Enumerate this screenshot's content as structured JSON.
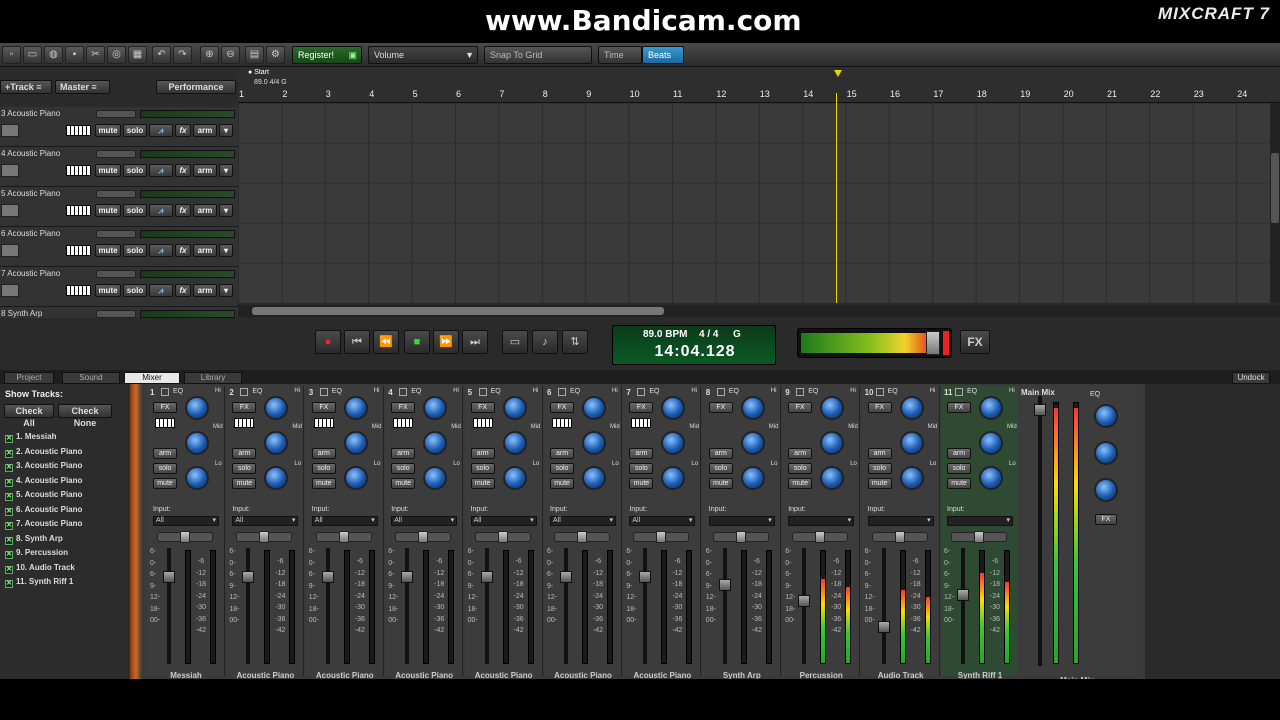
{
  "watermark": "www.Bandicam.com",
  "logo": "MIXCRAFT 7",
  "toolbar": {
    "register_label": "Register!",
    "volume_label": "Volume",
    "snap_label": "Snap To Grid",
    "time_label": "Time",
    "beats_label": "Beats"
  },
  "track_header": {
    "add_track": "+Track",
    "master": "Master",
    "performance": "Performance",
    "tracks": [
      {
        "name": "3 Acoustic Piano"
      },
      {
        "name": "4 Acoustic Piano"
      },
      {
        "name": "5 Acoustic Piano"
      },
      {
        "name": "6 Acoustic Piano"
      },
      {
        "name": "7 Acoustic Piano"
      },
      {
        "name": "8 Synth Arp"
      }
    ],
    "mute": "mute",
    "solo": "solo",
    "fx": "fx",
    "arm": "arm"
  },
  "ruler": {
    "marker": "Start",
    "tempo_sig": "89.0 4/4 G",
    "numbers": [
      "1",
      "2",
      "3",
      "4",
      "5",
      "6",
      "7",
      "8",
      "9",
      "10",
      "11",
      "12",
      "13",
      "14",
      "15",
      "16",
      "17",
      "18",
      "19",
      "20",
      "21",
      "22",
      "23",
      "24"
    ]
  },
  "lcd": {
    "bpm": "89.0 BPM",
    "sig": "4 / 4",
    "key": "G",
    "time": "14:04.128"
  },
  "master_fx": "FX",
  "tabs": [
    "Project",
    "Sound",
    "Mixer",
    "Library"
  ],
  "undock": "Undock",
  "show_tracks": {
    "title": "Show Tracks:",
    "check_all": "Check All",
    "check_none": "Check None",
    "items": [
      "1. Messiah",
      "2. Acoustic Piano",
      "3. Acoustic Piano",
      "4. Acoustic Piano",
      "5. Acoustic Piano",
      "6. Acoustic Piano",
      "7. Acoustic Piano",
      "8. Synth Arp",
      "9. Percussion",
      "10. Audio Track",
      "11. Synth Riff 1"
    ]
  },
  "mixer": {
    "eq": "EQ",
    "hi": "Hi",
    "mid": "Mid",
    "lo": "Lo",
    "fx": "FX",
    "arm": "arm",
    "solo": "solo",
    "mute": "mute",
    "input_label": "Input:",
    "input_all": "All",
    "main_mix": "Main Mix",
    "fader_scale": [
      "6-",
      "0-",
      "6-",
      "9-",
      "12-",
      "18-",
      "00-"
    ],
    "meter_scale": [
      "-6",
      "-12",
      "-18",
      "-24",
      "-30",
      "-36",
      "-42"
    ],
    "strips": [
      {
        "num": "1",
        "name": "Messiah",
        "level": 0.0
      },
      {
        "num": "2",
        "name": "Acoustic Piano",
        "level": 0.0
      },
      {
        "num": "3",
        "name": "Acoustic Piano",
        "level": 0.0
      },
      {
        "num": "4",
        "name": "Acoustic Piano",
        "level": 0.0
      },
      {
        "num": "5",
        "name": "Acoustic Piano",
        "level": 0.0
      },
      {
        "num": "6",
        "name": "Acoustic Piano",
        "level": 0.0
      },
      {
        "num": "7",
        "name": "Acoustic Piano",
        "level": 0.0
      },
      {
        "num": "8",
        "name": "Synth Arp",
        "level": 0.0
      },
      {
        "num": "9",
        "name": "Percussion",
        "level": 0.75
      },
      {
        "num": "10",
        "name": "Audio Track",
        "level": 0.65
      },
      {
        "num": "11",
        "name": "Synth Riff 1",
        "level": 0.8
      }
    ]
  }
}
